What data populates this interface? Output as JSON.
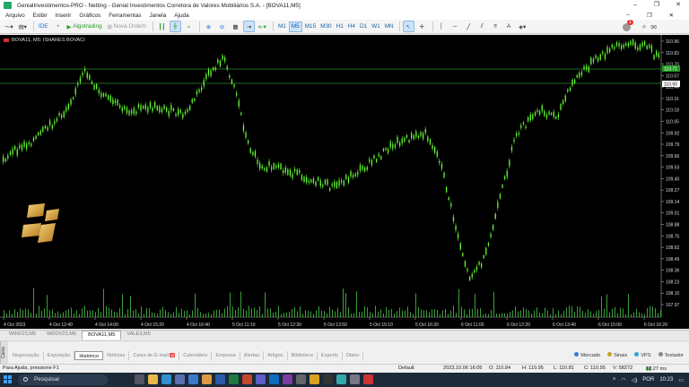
{
  "window": {
    "title": "GenialInvestimentos-PRO - Netting - Genial Investimentos Corretora de Valores Mobiliários S.A. - [BOVA11,M5]",
    "minimize": "–",
    "restore": "❐",
    "close": "✕"
  },
  "menu": {
    "items": [
      "Arquivo",
      "Exibir",
      "Inserir",
      "Gráficos",
      "Ferramentas",
      "Janela",
      "Ajuda"
    ],
    "right": [
      "–",
      "❐",
      "✕"
    ]
  },
  "toolbar": {
    "ide_label": "IDE",
    "algotrading_label": "Algotrading",
    "nova_ordem_label": "Nova Ordem",
    "timeframes": [
      "M1",
      "M5",
      "M15",
      "M30",
      "H1",
      "H4",
      "D1",
      "W1",
      "MN"
    ],
    "active_timeframe": "M5",
    "notification_count": "1"
  },
  "chart": {
    "symbol_title": "BOVA11, M5:  ISHARES BOVACI",
    "background": "#000000",
    "bull_color": "#66ff33",
    "level_line_color": "#2e8b2e",
    "price_labels": [
      "110.96",
      "110.83",
      "110.70",
      "110.57",
      "110.44",
      "110.31",
      "110.18",
      "110.05",
      "109.92",
      "109.79",
      "109.66",
      "109.53",
      "109.40",
      "109.27",
      "109.14",
      "109.01",
      "108.88",
      "108.75",
      "108.62",
      "108.49",
      "108.36",
      "108.23",
      "108.10",
      "107.97"
    ],
    "current_price_badge": "110.71",
    "level_price_badge": "110.50",
    "time_labels": [
      "4 Oct 2023",
      "4 Oct 12:40",
      "4 Oct 14:00",
      "4 Oct 15:20",
      "4 Oct 16:40",
      "5 Oct 11:10",
      "5 Oct 12:30",
      "5 Oct 13:50",
      "5 Oct 15:10",
      "5 Oct 16:30",
      "6 Oct 11:00",
      "6 Oct 12:20",
      "6 Oct 13:40",
      "6 Oct 15:00",
      "6 Oct 16:20"
    ]
  },
  "chart_tabs": {
    "items": [
      "WINV23,M5",
      "WDOV23,M5",
      "BOVA11,M5",
      "VALE3,M5"
    ],
    "active": "BOVA11,M5"
  },
  "panel": {
    "side_label": "Caixa",
    "tabs": [
      "Negociação",
      "Exposição",
      "Histórico",
      "Notícias",
      "Caixa de E-mail",
      "Calendário",
      "Empresa",
      "Alertas",
      "Artigos",
      "Biblioteca",
      "Experts",
      "Diário"
    ],
    "active_tab": "Histórico",
    "mail_badge": "16",
    "right_items": [
      "Mercado",
      "Sinais",
      "VPS",
      "Testador"
    ]
  },
  "status": {
    "help": "Para Ajuda, pressione F1",
    "profile": "Default",
    "datetime": "2023.10.06 16:05",
    "open": "O: 110.84",
    "high": "H: 110.95",
    "low": "L: 110.81",
    "close": "C: 110.95",
    "volume": "V: 58272",
    "ping": "62.27 ms"
  },
  "taskbar": {
    "search_placeholder": "Pesquisar",
    "lang": "POR",
    "time": "10:23"
  }
}
